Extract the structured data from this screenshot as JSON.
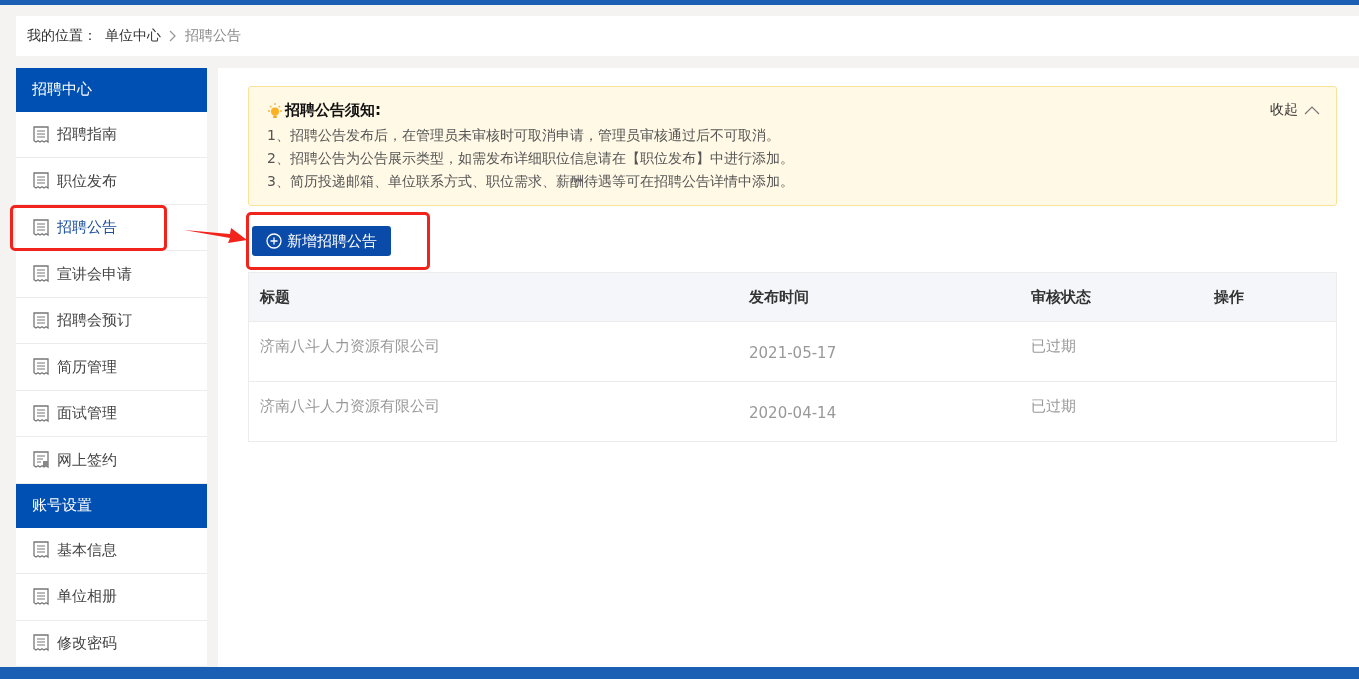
{
  "breadcrumb": {
    "label": "我的位置：",
    "items": [
      "单位中心",
      "招聘公告"
    ]
  },
  "sidebar": {
    "groups": [
      {
        "title": "招聘中心",
        "items": [
          {
            "label": "招聘指南",
            "selected": false,
            "kind": "doc",
            "annotated": false
          },
          {
            "label": "职位发布",
            "selected": false,
            "kind": "doc",
            "annotated": false
          },
          {
            "label": "招聘公告",
            "selected": true,
            "kind": "doc",
            "annotated": true
          },
          {
            "label": "宣讲会申请",
            "selected": false,
            "kind": "doc",
            "annotated": false
          },
          {
            "label": "招聘会预订",
            "selected": false,
            "kind": "doc",
            "annotated": false
          },
          {
            "label": "简历管理",
            "selected": false,
            "kind": "doc",
            "annotated": false
          },
          {
            "label": "面试管理",
            "selected": false,
            "kind": "doc",
            "annotated": false
          },
          {
            "label": "网上签约",
            "selected": false,
            "kind": "contract",
            "annotated": false
          }
        ]
      },
      {
        "title": "账号设置",
        "items": [
          {
            "label": "基本信息",
            "selected": false,
            "kind": "doc",
            "annotated": false
          },
          {
            "label": "单位相册",
            "selected": false,
            "kind": "doc",
            "annotated": false
          },
          {
            "label": "修改密码",
            "selected": false,
            "kind": "doc",
            "annotated": false
          }
        ]
      }
    ]
  },
  "notice": {
    "title": "招聘公告须知:",
    "collapse": "收起",
    "expanded": true,
    "lines": [
      "1、招聘公告发布后，在管理员未审核时可取消申请，管理员审核通过后不可取消。",
      "2、招聘公告为公告展示类型，如需发布详细职位信息请在【职位发布】中进行添加。",
      "3、简历投递邮箱、单位联系方式、职位需求、薪酬待遇等可在招聘公告详情中添加。"
    ]
  },
  "add_button": {
    "label": "新增招聘公告",
    "annotated": true
  },
  "table": {
    "columns": [
      "标题",
      "发布时间",
      "审核状态",
      "操作"
    ],
    "rows": [
      [
        "济南八斗人力资源有限公司",
        "2021-05-17",
        "已过期",
        ""
      ],
      [
        "济南八斗人力资源有限公司",
        "2020-04-14",
        "已过期",
        ""
      ]
    ]
  }
}
